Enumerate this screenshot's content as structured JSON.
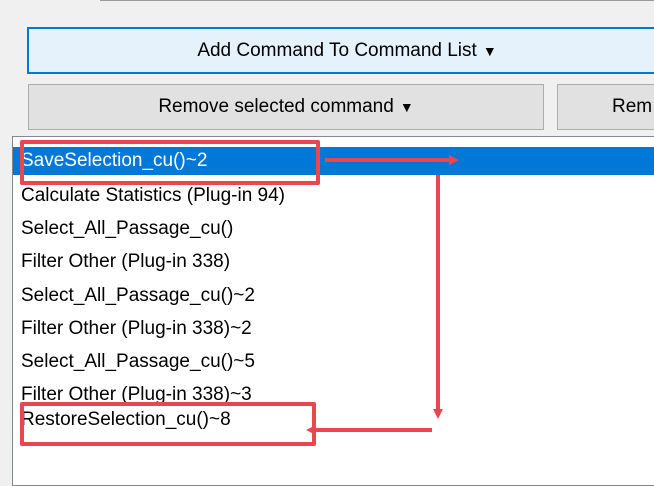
{
  "toolbar": {
    "add_label": "Add Command To Command List",
    "remove_selected_label": "Remove selected command",
    "remove_other_label": "Rem",
    "caret": "▼"
  },
  "list": {
    "items": [
      "SaveSelection_cu()~2",
      "Calculate Statistics (Plug-in 94)",
      "Select_All_Passage_cu()",
      "Filter Other (Plug-in 338)",
      "Select_All_Passage_cu()~2",
      "Filter Other (Plug-in 338)~2",
      "Select_All_Passage_cu()~5",
      "Filter Other (Plug-in 338)~3",
      "RestoreSelection_cu()~8"
    ],
    "selected_index": 0
  },
  "colors": {
    "selection": "#0078d7",
    "annotation": "#e8474f"
  }
}
